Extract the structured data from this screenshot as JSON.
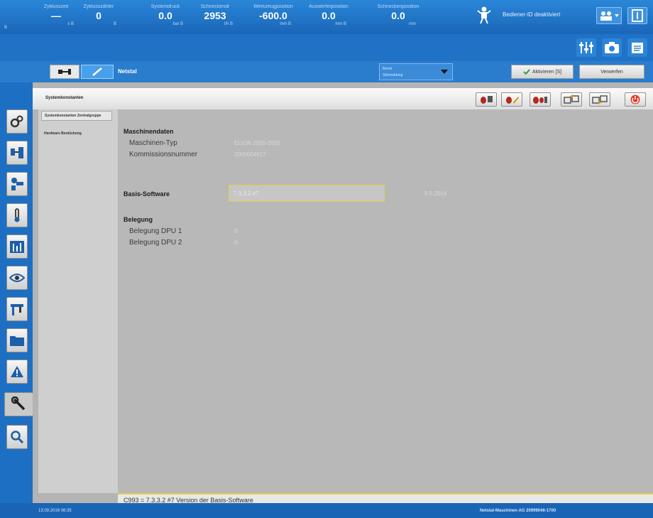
{
  "topbar": {
    "left_mark": "B",
    "readouts": [
      {
        "label": "Zyklusszeit",
        "value": "—",
        "unit": "s  B"
      },
      {
        "label": "Zyklusszähler",
        "value": "0",
        "unit": "B"
      },
      {
        "label": "Systemdruck",
        "value": "0.0",
        "unit": "bar  B"
      },
      {
        "label": "Schneckendr",
        "value": "2953",
        "unit": "l/h  B"
      },
      {
        "label": "Werkzeugposition",
        "value": "-600.0",
        "unit": "mm  B"
      },
      {
        "label": "Auswerferposition",
        "value": "0.0",
        "unit": "mm  B"
      },
      {
        "label": "Schneckenposition",
        "value": "0.0",
        "unit": "mm"
      }
    ],
    "operator_status": "Bediener-ID deaktiviert"
  },
  "toolbar": {
    "title": "Netstal",
    "status_line_1": "Bereit",
    "status_line_2": "Störmeldung",
    "activate_label": "Aktivieren [S]",
    "discard_label": "Verwerfen"
  },
  "panel": {
    "section_title": "Systemkonstanten",
    "subnav": [
      "Systemkonstanten Zentralgruppe",
      "Hardware Bestückung"
    ],
    "machine_group": "Maschinendaten",
    "machine_type_label": "Maschinen-Typ",
    "machine_type_value": "ELION 2000-2000",
    "commission_label": "Kommissionsnummer",
    "commission_value": "2000004617",
    "basis_label": "Basis-Software",
    "basis_value": "7.3.3.2 #7",
    "basis_date": "9.9.2016",
    "belegung_group": "Belegung",
    "dpu1_label": "Belegung DPU 1",
    "dpu1_value": "0",
    "dpu2_label": "Belegung DPU 2",
    "dpu2_value": "0",
    "info_text": "C993 = 7.3.3.2 #7   Version der Basis-Software"
  },
  "footer": {
    "datetime": "13.09.2016  06:35",
    "company": "Netstal-Maschinen AG  20999046-1700"
  },
  "colors": {
    "primary_blue": "#1d6fc4",
    "panel_gray": "#b8b8b8",
    "highlight_yellow": "#e2d04a",
    "stop_red": "#e03a2a"
  }
}
